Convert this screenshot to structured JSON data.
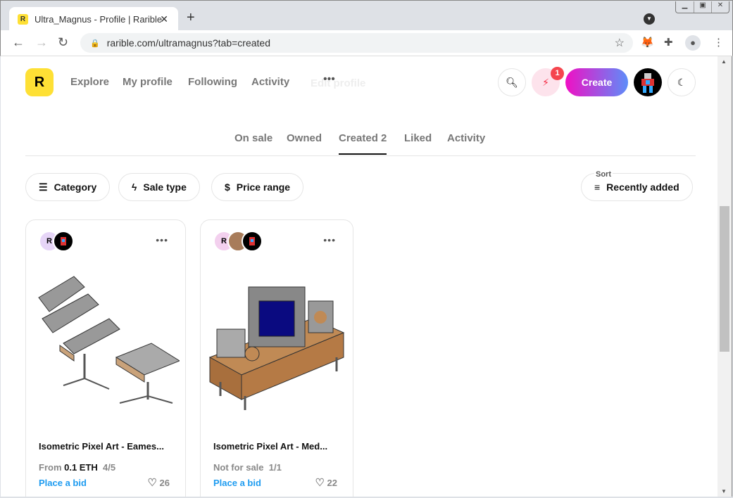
{
  "browser": {
    "tab_title": "Ultra_Magnus - Profile | Rarible",
    "url": "rarible.com/ultramagnus?tab=created"
  },
  "header": {
    "logo": "R",
    "nav": [
      "Explore",
      "My profile",
      "Following",
      "Activity"
    ],
    "ghost_text": "Edit profile",
    "notification_count": "1",
    "create_label": "Create"
  },
  "tabs": [
    {
      "label": "On sale"
    },
    {
      "label": "Owned"
    },
    {
      "label": "Created",
      "count": "2",
      "active": true
    },
    {
      "label": "Liked"
    },
    {
      "label": "Activity"
    }
  ],
  "filters": {
    "category": "Category",
    "sale_type": "Sale type",
    "price_range": "Price range",
    "sort_label": "Sort",
    "sort_value": "Recently added"
  },
  "cards": [
    {
      "title": "Isometric Pixel Art - Eames...",
      "price_prefix": "From",
      "price": "0.1 ETH",
      "edition": "4/5",
      "action": "Place a bid",
      "likes": "26"
    },
    {
      "title": "Isometric Pixel Art - Med...",
      "price_prefix": "Not for sale",
      "price": "",
      "edition": "1/1",
      "action": "Place a bid",
      "likes": "22"
    }
  ],
  "colors": {
    "brand": "#fee035",
    "create_gradient": [
      "#f010c4",
      "#5d8df9"
    ],
    "link": "#1d9bf0",
    "badge": "#f5454e"
  }
}
